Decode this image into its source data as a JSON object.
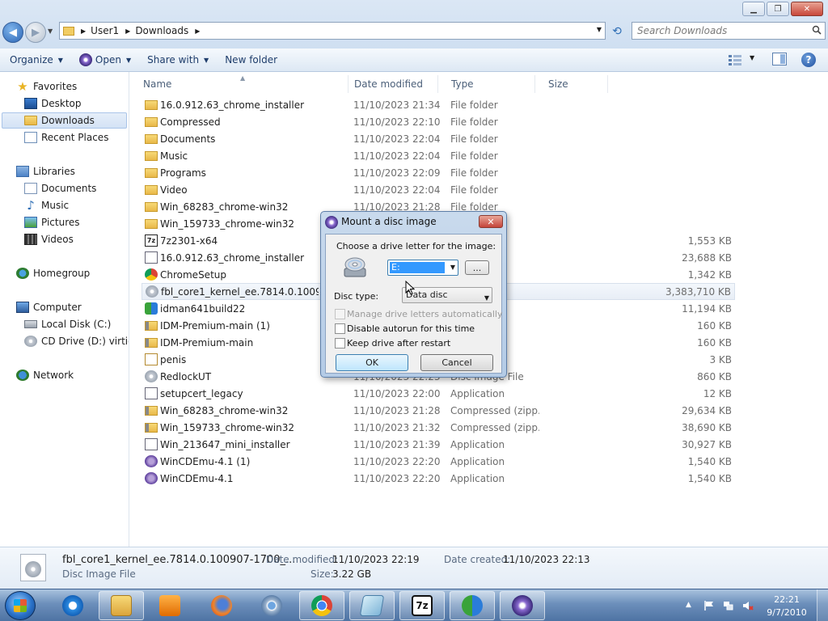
{
  "window": {
    "minimize_icon": "minimize-icon",
    "maximize_icon": "maximize-icon",
    "close_icon": "close-icon"
  },
  "address": {
    "crumbs": [
      "User1",
      "Downloads"
    ],
    "search_placeholder": "Search Downloads"
  },
  "toolbar": {
    "organize": "Organize",
    "open": "Open",
    "share_with": "Share with",
    "new_folder": "New folder"
  },
  "nav": {
    "favorites": "Favorites",
    "desktop": "Desktop",
    "downloads": "Downloads",
    "recent_places": "Recent Places",
    "libraries": "Libraries",
    "documents": "Documents",
    "music": "Music",
    "pictures": "Pictures",
    "videos": "Videos",
    "homegroup": "Homegroup",
    "computer": "Computer",
    "local_disk": "Local Disk (C:)",
    "cd_drive": "CD Drive (D:) virtio-w",
    "network": "Network"
  },
  "columns": {
    "name": "Name",
    "date": "Date modified",
    "type": "Type",
    "size": "Size"
  },
  "files": [
    {
      "name": "16.0.912.63_chrome_installer",
      "date": "11/10/2023 21:34",
      "type": "File folder",
      "size": ""
    },
    {
      "name": "Compressed",
      "date": "11/10/2023 22:10",
      "type": "File folder",
      "size": ""
    },
    {
      "name": "Documents",
      "date": "11/10/2023 22:04",
      "type": "File folder",
      "size": ""
    },
    {
      "name": "Music",
      "date": "11/10/2023 22:04",
      "type": "File folder",
      "size": ""
    },
    {
      "name": "Programs",
      "date": "11/10/2023 22:09",
      "type": "File folder",
      "size": ""
    },
    {
      "name": "Video",
      "date": "11/10/2023 22:04",
      "type": "File folder",
      "size": ""
    },
    {
      "name": "Win_68283_chrome-win32",
      "date": "11/10/2023 21:28",
      "type": "File folder",
      "size": ""
    },
    {
      "name": "Win_159733_chrome-win32",
      "date": "",
      "type": "",
      "size": ""
    },
    {
      "name": "7z2301-x64",
      "date": "",
      "type": "",
      "size": "1,553 KB"
    },
    {
      "name": "16.0.912.63_chrome_installer",
      "date": "",
      "type": "",
      "size": "23,688 KB"
    },
    {
      "name": "ChromeSetup",
      "date": "",
      "type": "",
      "size": "1,342 KB"
    },
    {
      "name": "fbl_core1_kernel_ee.7814.0.100907-1700",
      "date": "",
      "type": "le",
      "size": "3,383,710 KB"
    },
    {
      "name": "idman641build22",
      "date": "",
      "type": "",
      "size": "11,194 KB"
    },
    {
      "name": "IDM-Premium-main (1)",
      "date": "",
      "type": "(zipp...",
      "size": "160 KB"
    },
    {
      "name": "IDM-Premium-main",
      "date": "",
      "type": "(zipp...",
      "size": "160 KB"
    },
    {
      "name": "penis",
      "date": "",
      "type": "ificate",
      "size": "3 KB"
    },
    {
      "name": "RedlockUT",
      "date": "11/10/2023 22:23",
      "type": "Disc Image File",
      "size": "860 KB"
    },
    {
      "name": "setupcert_legacy",
      "date": "11/10/2023 22:00",
      "type": "Application",
      "size": "12 KB"
    },
    {
      "name": "Win_68283_chrome-win32",
      "date": "11/10/2023 21:28",
      "type": "Compressed (zipp...",
      "size": "29,634 KB"
    },
    {
      "name": "Win_159733_chrome-win32",
      "date": "11/10/2023 21:32",
      "type": "Compressed (zipp...",
      "size": "38,690 KB"
    },
    {
      "name": "Win_213647_mini_installer",
      "date": "11/10/2023 21:39",
      "type": "Application",
      "size": "30,927 KB"
    },
    {
      "name": "WinCDEmu-4.1 (1)",
      "date": "11/10/2023 22:20",
      "type": "Application",
      "size": "1,540 KB"
    },
    {
      "name": "WinCDEmu-4.1",
      "date": "11/10/2023 22:20",
      "type": "Application",
      "size": "1,540 KB"
    }
  ],
  "details": {
    "filename": "fbl_core1_kernel_ee.7814.0.100907-1700_...",
    "filetype": "Disc Image File",
    "date_modified_label": "Date modified:",
    "date_modified": "11/10/2023 22:19",
    "date_created_label": "Date created:",
    "date_created": "11/10/2023 22:13",
    "size_label": "Size:",
    "size": "3.22 GB"
  },
  "dialog": {
    "title": "Mount a disc image",
    "close_label": "✕",
    "choose_label": "Choose a drive letter for the image:",
    "drive_value": "E:",
    "browse_label": "...",
    "disc_type_label": "Disc type:",
    "disc_type_value": "Data disc",
    "opt_manage": "Manage drive letters automatically",
    "opt_autorun": "Disable autorun for this time",
    "opt_keep": "Keep drive after restart",
    "ok": "OK",
    "cancel": "Cancel"
  },
  "taskbar": {
    "time": "22:21",
    "date": "9/7/2010",
    "sevenzip_label": "7z"
  }
}
